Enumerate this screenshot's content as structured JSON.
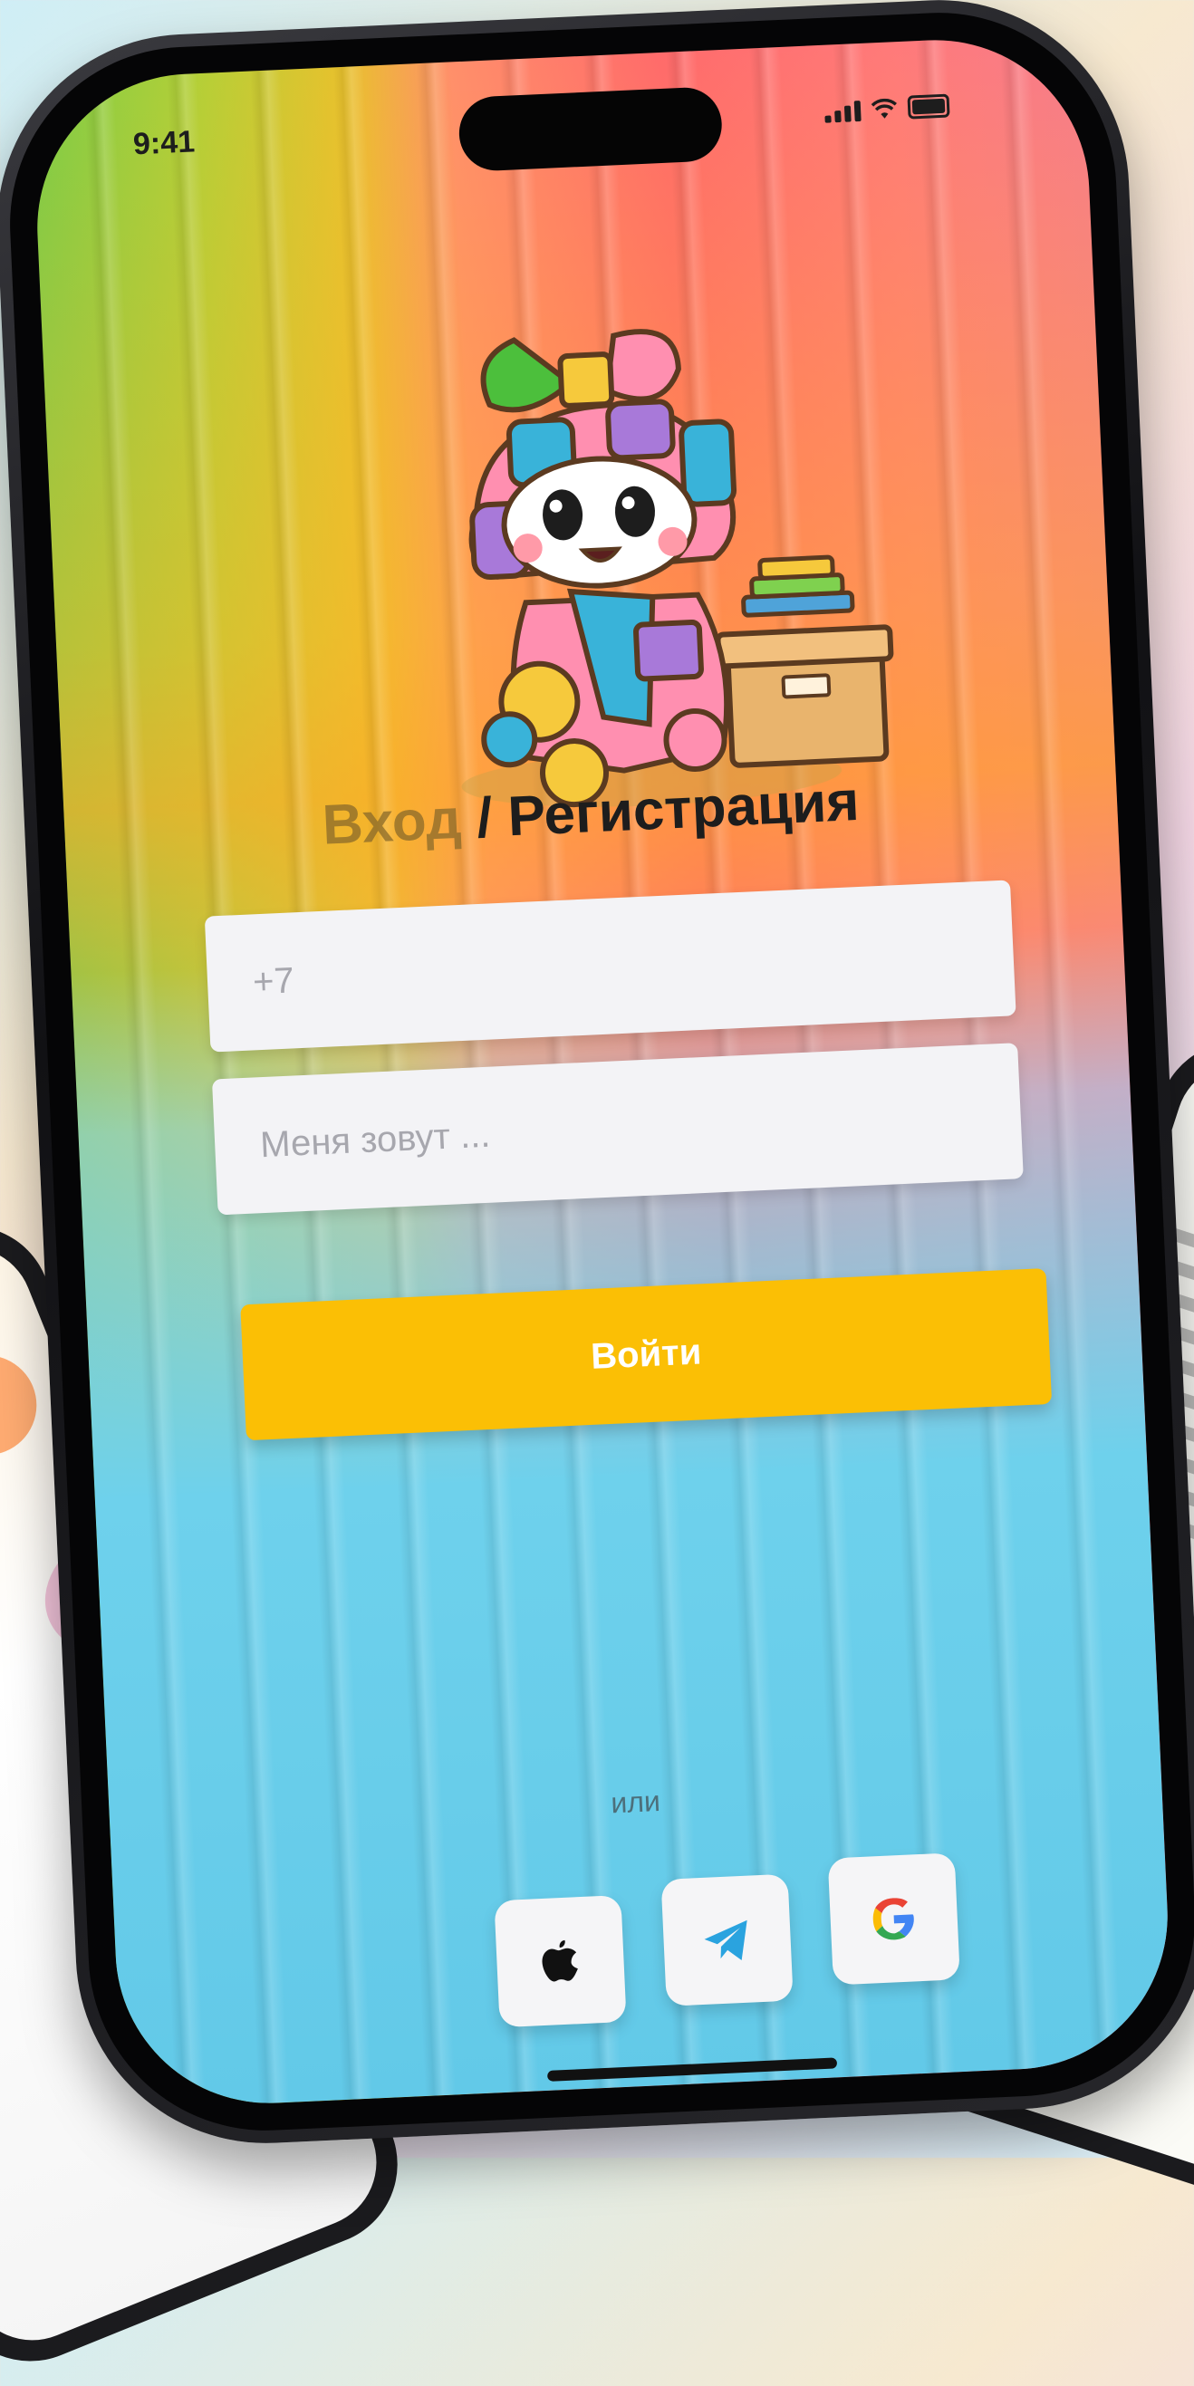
{
  "status_bar": {
    "time": "9:41"
  },
  "auth": {
    "title_login": "Вход",
    "title_separator": " / ",
    "title_register": "Регистрация"
  },
  "form": {
    "phone_placeholder": "+7",
    "name_placeholder": "Меня зовут ...",
    "submit_label": "Войти"
  },
  "alt_login": {
    "or_label": "или",
    "providers": [
      {
        "icon": "apple-icon"
      },
      {
        "icon": "telegram-icon"
      },
      {
        "icon": "google-icon"
      }
    ]
  },
  "colors": {
    "primary_button": "#fbbf05",
    "field_bg": "#f3f3f6",
    "telegram": "#2aa3df"
  }
}
